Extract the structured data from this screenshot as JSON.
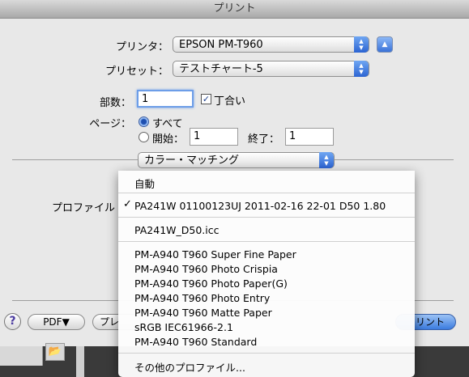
{
  "window": {
    "title": "プリント"
  },
  "printer": {
    "label": "プリンタ：",
    "value": "EPSON PM-T960"
  },
  "preset": {
    "label": "プリセット：",
    "value": "テストチャート-5"
  },
  "copies": {
    "label": "部数：",
    "value": "1",
    "collate_label": "丁合い",
    "collate_checked": true
  },
  "pages": {
    "label": "ページ：",
    "all_label": "すべて",
    "from_label": "開始：",
    "from_value": "1",
    "to_label": "終了：",
    "to_value": "1"
  },
  "section": {
    "value": "カラー・マッチング"
  },
  "profile": {
    "label": "プロファイル"
  },
  "buttons": {
    "help": "?",
    "pdf": "PDF▼",
    "preview": "プレ",
    "print": "リント"
  },
  "profile_menu": {
    "items": [
      {
        "label": "自動",
        "checked": false
      },
      {
        "label": "PA241W 01100123UJ 2011-02-16 22-01 D50 1.80",
        "checked": true
      },
      {
        "label": "PA241W_D50.icc",
        "checked": false
      },
      {
        "label": "PM-A940 T960 Super Fine Paper",
        "checked": false
      },
      {
        "label": "PM-A940 T960 Photo Crispia",
        "checked": false
      },
      {
        "label": "PM-A940 T960 Photo Paper(G)",
        "checked": false
      },
      {
        "label": "PM-A940 T960 Photo Entry",
        "checked": false
      },
      {
        "label": "PM-A940 T960 Matte Paper",
        "checked": false
      },
      {
        "label": "sRGB IEC61966-2.1",
        "checked": false
      },
      {
        "label": "PM-A940 T960 Standard",
        "checked": false
      },
      {
        "label": "その他のプロファイル...",
        "checked": false
      }
    ],
    "check_glyph": "✓"
  },
  "colors": {
    "accent": "#3b7bdf",
    "sheet": "#e8e8e8",
    "desktop": "#3a3a3a"
  }
}
